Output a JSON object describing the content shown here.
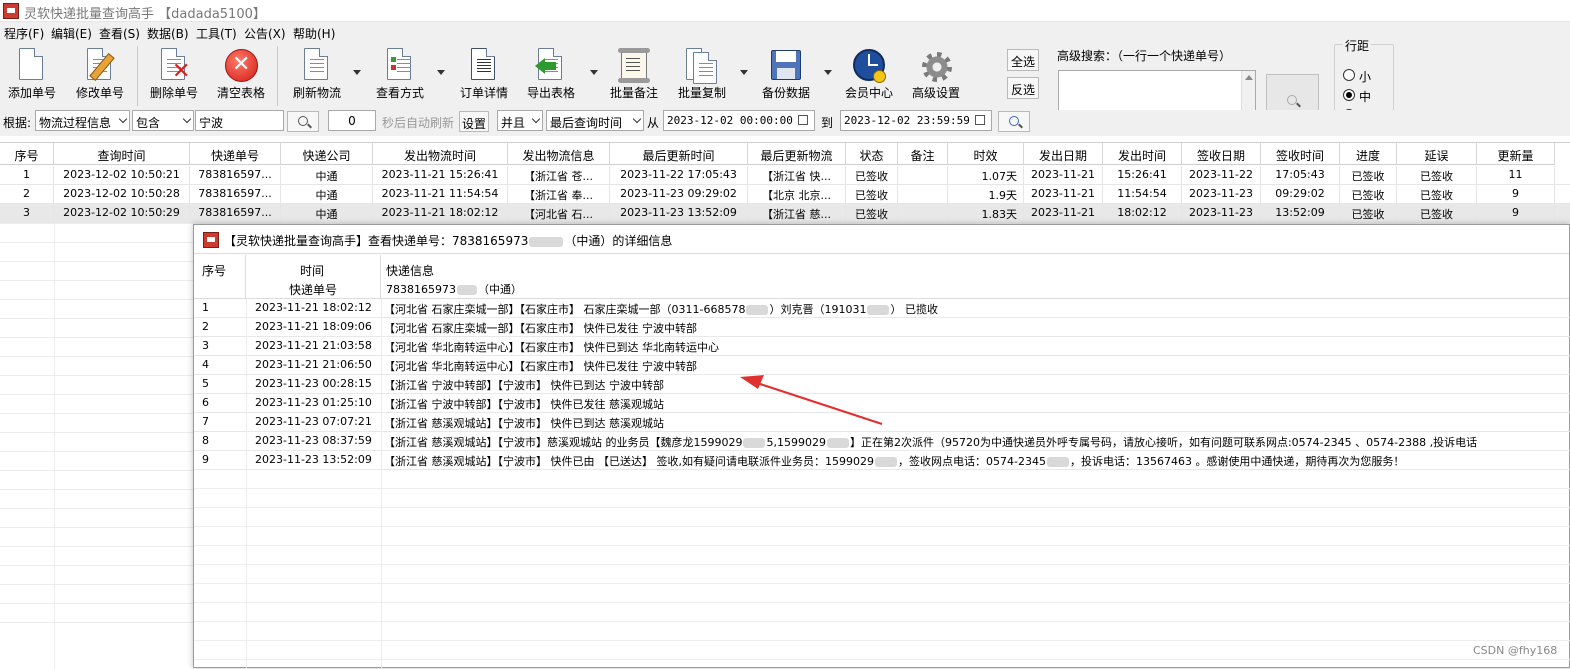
{
  "title": "灵软快递批量查询高手 【dadada5100】",
  "menu": [
    "程序(F)",
    "编辑(E)",
    "查看(S)",
    "数据(B)",
    "工具(T)",
    "公告(X)",
    "帮助(H)"
  ],
  "toolbar": {
    "add": "添加单号",
    "edit": "修改单号",
    "delete": "删除单号",
    "clear": "清空表格",
    "refresh": "刷新物流",
    "view_mode": "查看方式",
    "order_detail": "订单详情",
    "export": "导出表格",
    "batch_note": "批量备注",
    "batch_copy": "批量复制",
    "backup": "备份数据",
    "member": "会员中心",
    "advanced": "高级设置",
    "select_all": "全选",
    "invert": "反选",
    "advanced_search_label": "高级搜索：（一行一个快递单号）",
    "spacing_label": "行距",
    "spacing_small": "小",
    "spacing_medium": "中",
    "spacing_large": "大"
  },
  "filter": {
    "by_label": "根据:",
    "field": "物流过程信息",
    "condition": "包含",
    "keyword": "宁波",
    "seconds": "0",
    "auto_refresh_label": "秒后自动刷新",
    "set_button": "设置",
    "logic": "并且",
    "time_field": "最后查询时间",
    "from_label": "从",
    "from_value": "2023-12-02 00:00:00",
    "to_label": "到",
    "to_value": "2023-12-02 23:59:59"
  },
  "grid": {
    "headers": [
      "序号",
      "查询时间",
      "快递单号",
      "快递公司",
      "发出物流时间",
      "发出物流信息",
      "最后更新时间",
      "最后更新物流",
      "状态",
      "备注",
      "时效",
      "发出日期",
      "发出时间",
      "签收日期",
      "签收时间",
      "进度",
      "延误",
      "更新量"
    ],
    "rows": [
      [
        "1",
        "2023-12-02 10:50:21",
        "783816597...",
        "中通",
        "2023-11-21 15:26:41",
        "【浙江省 苍...",
        "2023-11-22 17:05:43",
        "【浙江省 快...",
        "已签收",
        "",
        "1.07天",
        "2023-11-21",
        "15:26:41",
        "2023-11-22",
        "17:05:43",
        "已签收",
        "已签收",
        "11"
      ],
      [
        "2",
        "2023-12-02 10:50:28",
        "783816597...",
        "中通",
        "2023-11-21 11:54:54",
        "【浙江省 奉...",
        "2023-11-23 09:29:02",
        "【北京 北京...",
        "已签收",
        "",
        "1.9天",
        "2023-11-21",
        "11:54:54",
        "2023-11-23",
        "09:29:02",
        "已签收",
        "已签收",
        "9"
      ],
      [
        "3",
        "2023-12-02 10:50:29",
        "783816597...",
        "中通",
        "2023-11-21 18:02:12",
        "【河北省 石...",
        "2023-11-23 13:52:09",
        "【浙江省 慈...",
        "已签收",
        "",
        "1.83天",
        "2023-11-21",
        "18:02:12",
        "2023-11-23",
        "13:52:09",
        "已签收",
        "已签收",
        "9"
      ]
    ]
  },
  "detail": {
    "title": "【灵软快递批量查询高手】查看快递单号：7838165973",
    "title_suffix": "（中通）的详细信息",
    "col_no": "序号",
    "col_time": "时间",
    "col_info": "快递信息",
    "sub_label": "快递单号",
    "sub_value": "7838165973",
    "sub_company": "（中通）",
    "rows": [
      {
        "no": "1",
        "time": "2023-11-21 18:02:12",
        "info": "【河北省 石家庄栾城一部】【石家庄市】 石家庄栾城一部（0311-668578",
        "info2": "）刘克晋（191031",
        "info3": "） 已揽收"
      },
      {
        "no": "2",
        "time": "2023-11-21 18:09:06",
        "info": "【河北省 石家庄栾城一部】【石家庄市】 快件已发往 宁波中转部",
        "info2": "",
        "info3": ""
      },
      {
        "no": "3",
        "time": "2023-11-21 21:03:58",
        "info": "【河北省 华北南转运中心】【石家庄市】 快件已到达 华北南转运中心",
        "info2": "",
        "info3": ""
      },
      {
        "no": "4",
        "time": "2023-11-21 21:06:50",
        "info": "【河北省 华北南转运中心】【石家庄市】 快件已发往 宁波中转部",
        "info2": "",
        "info3": ""
      },
      {
        "no": "5",
        "time": "2023-11-23 00:28:15",
        "info": "【浙江省 宁波中转部】【宁波市】 快件已到达 宁波中转部",
        "info2": "",
        "info3": ""
      },
      {
        "no": "6",
        "time": "2023-11-23 01:25:10",
        "info": "【浙江省 宁波中转部】【宁波市】 快件已发往 慈溪观城站",
        "info2": "",
        "info3": ""
      },
      {
        "no": "7",
        "time": "2023-11-23 07:07:21",
        "info": "【浙江省 慈溪观城站】【宁波市】 快件已到达 慈溪观城站",
        "info2": "",
        "info3": ""
      },
      {
        "no": "8",
        "time": "2023-11-23 08:37:59",
        "info": "【浙江省 慈溪观城站】【宁波市】慈溪观城站 的业务员【魏彦龙1599029",
        "info2": "5,1599029",
        "info3": "】正在第2次派件（95720为中通快递员外呼专属号码，请放心接听，如有问题可联系网点:0574-2345    、0574-2388    ,投诉电话"
      },
      {
        "no": "9",
        "time": "2023-11-23 13:52:09",
        "info": "【浙江省 慈溪观城站】【宁波市】 快件已由 【已送达】 签收,如有疑问请电联派件业务员：1599029",
        "info2": "，签收网点电话：0574-2345",
        "info3": "，投诉电话：13567463   。感谢使用中通快递，期待再次为您服务！"
      }
    ]
  },
  "watermark": "CSDN @fhy168",
  "colors": {
    "accent_red": "#e03030",
    "grid_line": "#e6e6e6",
    "toolbar_bg": "#f0f0f0"
  }
}
